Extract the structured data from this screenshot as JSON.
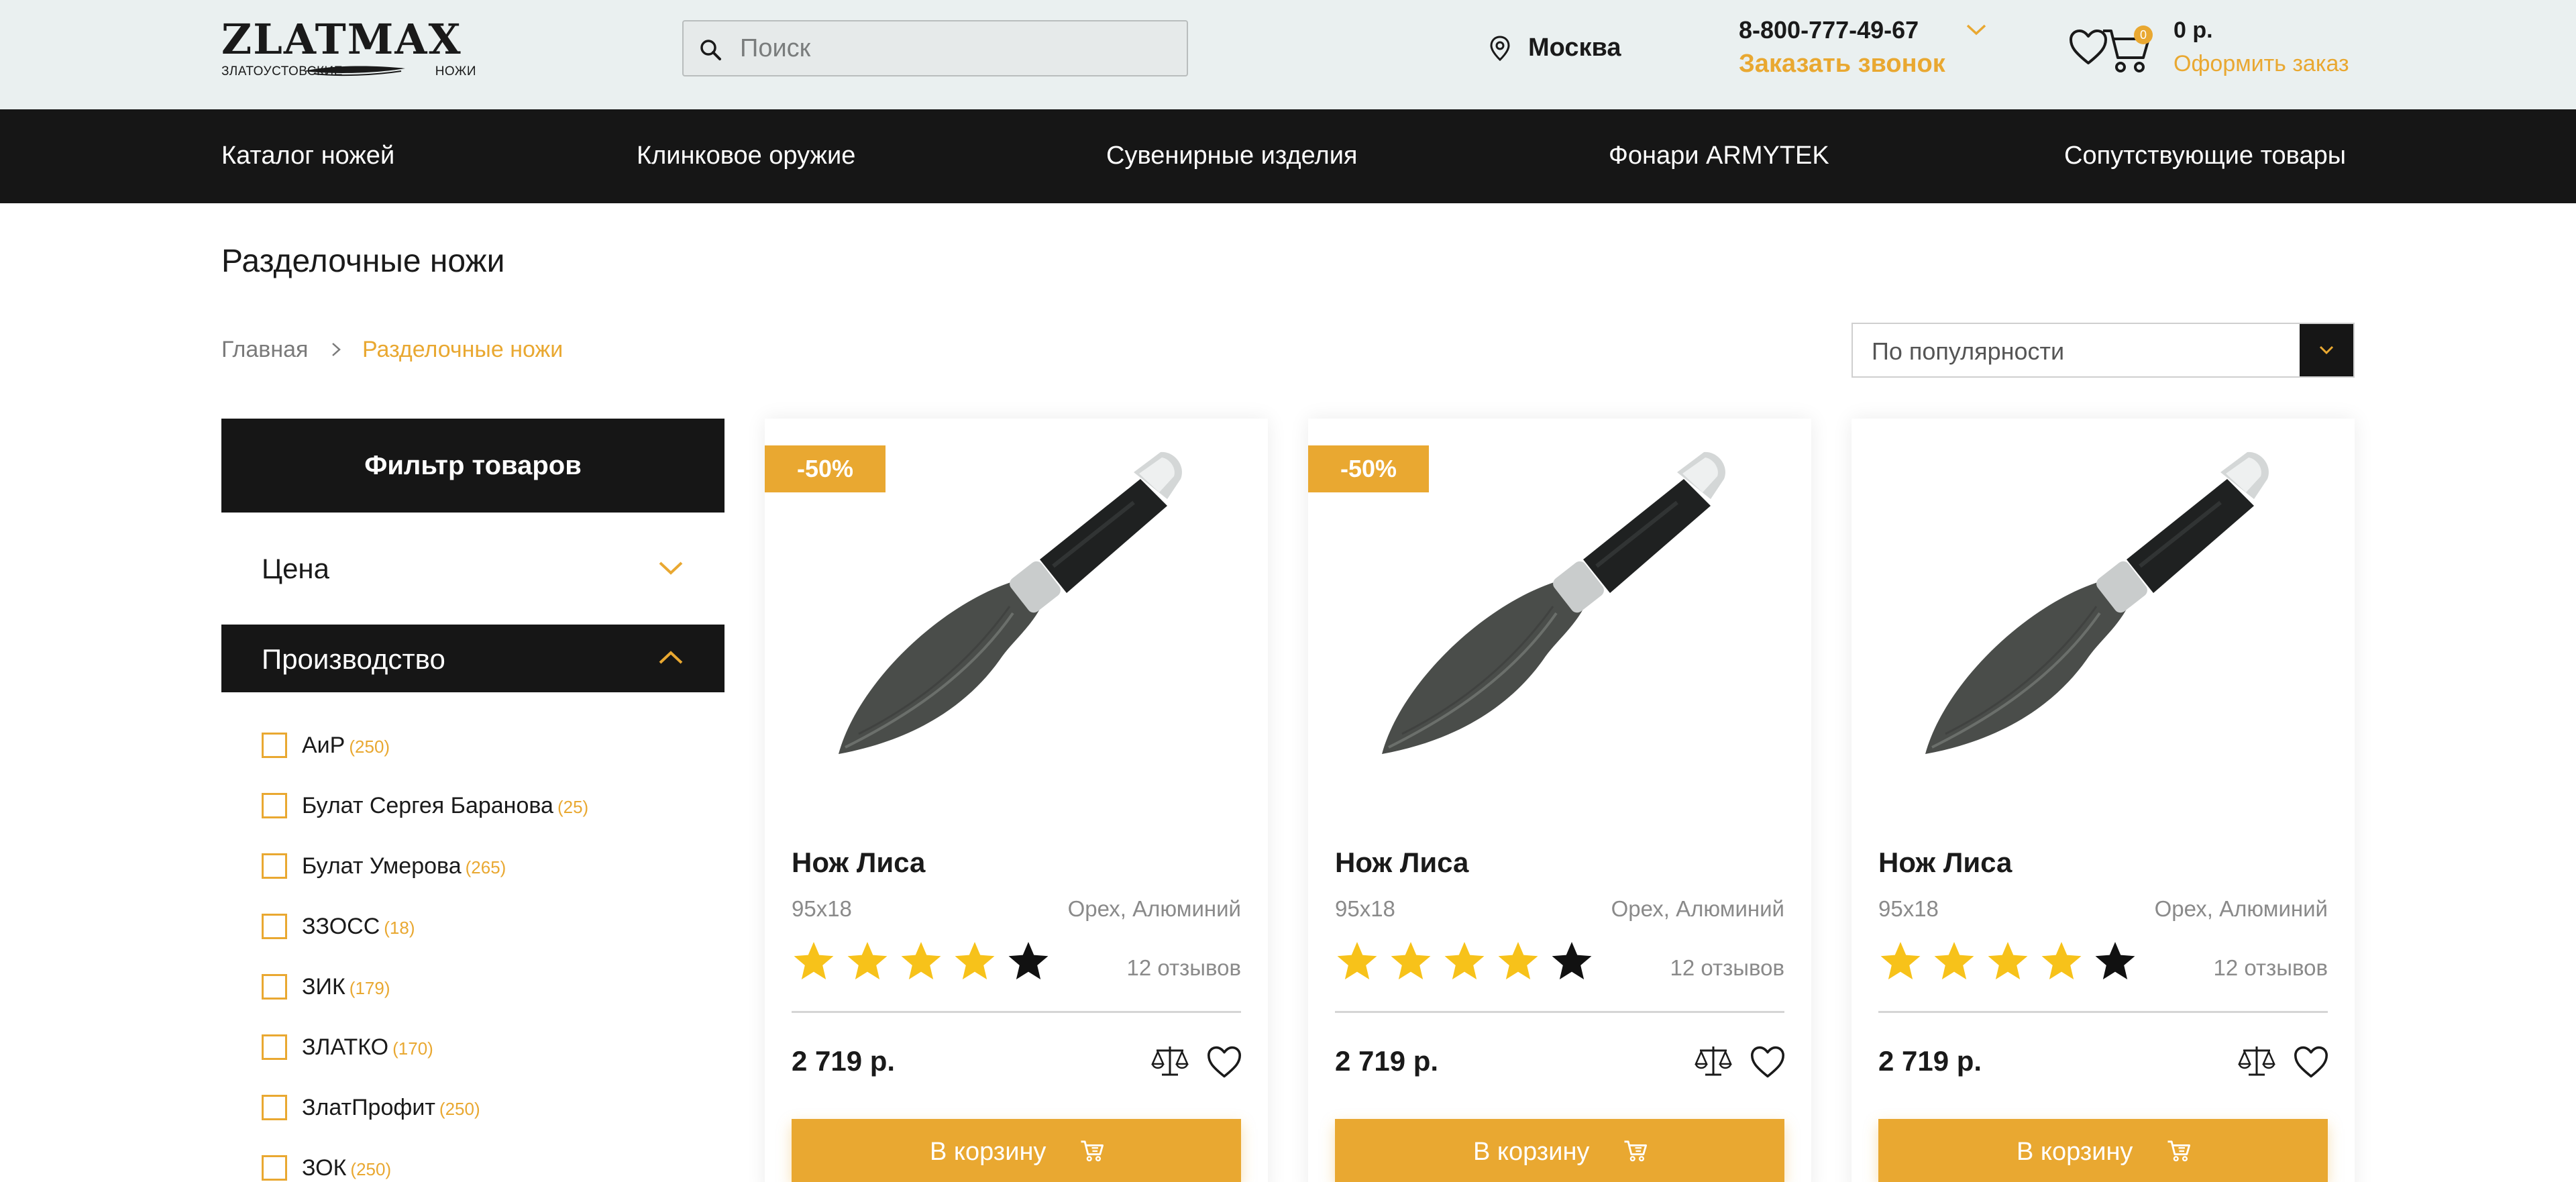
{
  "header": {
    "logo_main": "ZLATMAX",
    "logo_sub_left": "ЗЛАТОУСТОВСКИЕ",
    "logo_sub_right": "НОЖИ",
    "search_placeholder": "Поиск",
    "city": "Москва",
    "phone": "8-800-777-49-67",
    "callback_label": "Заказать звонок",
    "cart_count": "0",
    "cart_total": "0 р.",
    "checkout_label": "Оформить заказ",
    "icons": [
      "search-icon",
      "location-pin-icon",
      "chevron-down-icon",
      "heart-icon",
      "cart-icon"
    ]
  },
  "nav": {
    "items": [
      {
        "label": "Каталог ножей"
      },
      {
        "label": "Клинковое оружие"
      },
      {
        "label": "Сувенирные изделия"
      },
      {
        "label": "Фонари ARMYTEK"
      },
      {
        "label": "Сопутствующие товары"
      }
    ]
  },
  "page": {
    "title": "Разделочные ножи",
    "breadcrumb": {
      "home": "Главная",
      "current": "Разделочные ножи"
    },
    "sort_selected": "По популярности"
  },
  "filter": {
    "title": "Фильтр товаров",
    "price_label": "Цена",
    "maker_label": "Производство",
    "makers": [
      {
        "name": "АиР",
        "count": "(250)"
      },
      {
        "name": "Булат Сергея Баранова",
        "count": "(25)"
      },
      {
        "name": "Булат Умерова",
        "count": "(265)"
      },
      {
        "name": "ЗЗОСС",
        "count": "(18)"
      },
      {
        "name": "ЗИК",
        "count": "(179)"
      },
      {
        "name": "ЗЛАТКО",
        "count": "(170)"
      },
      {
        "name": "ЗлатПрофит",
        "count": "(250)"
      },
      {
        "name": "ЗОК",
        "count": "(250)"
      }
    ]
  },
  "products": [
    {
      "badge": "-50%",
      "title": "Нож Лиса",
      "size": "95x18",
      "material": "Орех, Алюминий",
      "rating": 4,
      "rating_max": 5,
      "reviews": "12 отзывов",
      "price": "2 719 р.",
      "buy_label": "В корзину"
    },
    {
      "badge": "-50%",
      "title": "Нож Лиса",
      "size": "95x18",
      "material": "Орех, Алюминий",
      "rating": 4,
      "rating_max": 5,
      "reviews": "12 отзывов",
      "price": "2 719 р.",
      "buy_label": "В корзину"
    },
    {
      "badge": "",
      "title": "Нож Лиса",
      "size": "95x18",
      "material": "Орех, Алюминий",
      "rating": 4,
      "rating_max": 5,
      "reviews": "12 отзывов",
      "price": "2 719 р.",
      "buy_label": "В корзину"
    }
  ],
  "colors": {
    "accent": "#e9a831",
    "dark": "#161616",
    "header_bg": "#eaf0f0",
    "star_filled": "#f7c21a",
    "star_empty": "#111111"
  }
}
